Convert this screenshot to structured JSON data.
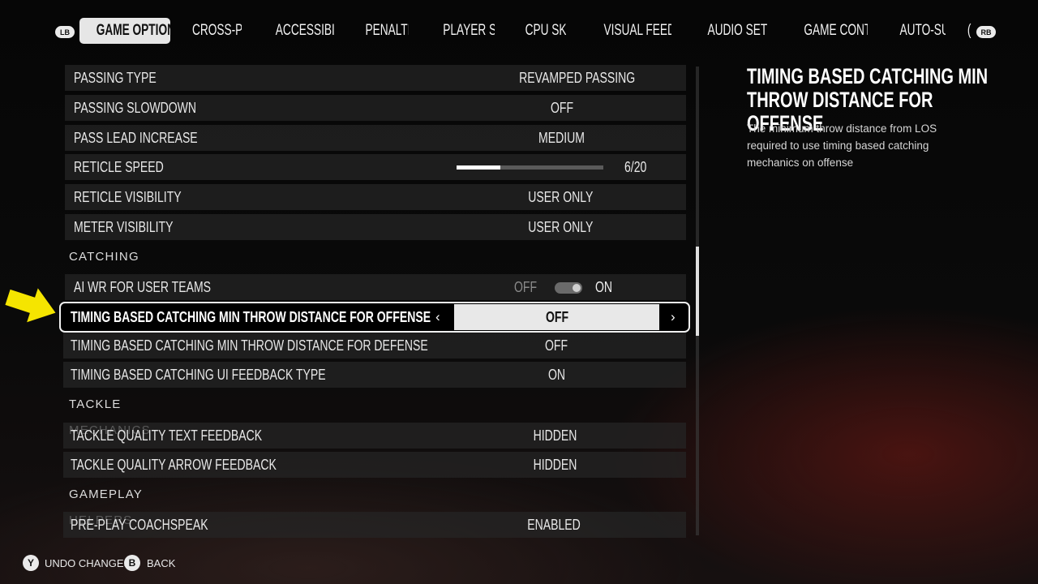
{
  "nav": {
    "left_bumper": "LB",
    "right_bumper": "RB",
    "tabs": [
      {
        "label": "GAME OPTIONS",
        "active": true
      },
      {
        "label": "CROSS-PLAY"
      },
      {
        "label": "ACCESSIBILITY"
      },
      {
        "label": "PENALTIES"
      },
      {
        "label": "PLAYER SKILL"
      },
      {
        "label": "CPU SKILL"
      },
      {
        "label": "VISUAL FEEDBACK"
      },
      {
        "label": "AUDIO SETTINGS"
      },
      {
        "label": "GAME CONTROLS"
      },
      {
        "label": "AUTO-SUBS"
      },
      {
        "label": "("
      }
    ]
  },
  "settings": {
    "passing_type": {
      "label": "PASSING TYPE",
      "value": "REVAMPED PASSING"
    },
    "passing_slowdown": {
      "label": "PASSING SLOWDOWN",
      "value": "OFF"
    },
    "pass_lead_increase": {
      "label": "PASS LEAD INCREASE",
      "value": "MEDIUM"
    },
    "reticle_speed": {
      "label": "RETICLE SPEED",
      "value_text": "6/20",
      "value": 6,
      "max": 20
    },
    "reticle_visibility": {
      "label": "RETICLE VISIBILITY",
      "value": "USER ONLY"
    },
    "meter_visibility": {
      "label": "METER VISIBILITY",
      "value": "USER ONLY"
    },
    "catching_header": "CATCHING",
    "ai_wr": {
      "label": "AI WR FOR USER TEAMS",
      "off": "OFF",
      "on": "ON",
      "state": "on"
    },
    "tbc_offense": {
      "label": "TIMING BASED CATCHING MIN THROW DISTANCE FOR OFFENSE",
      "value": "OFF",
      "prev": "‹",
      "next": "›"
    },
    "tbc_defense": {
      "label": "TIMING BASED CATCHING MIN THROW DISTANCE FOR DEFENSE",
      "value": "OFF"
    },
    "tbc_ui": {
      "label": "TIMING BASED CATCHING UI FEEDBACK TYPE",
      "value": "ON"
    },
    "tackle_header": "TACKLE MECHANICS",
    "tackle_text": {
      "label": "TACKLE QUALITY TEXT FEEDBACK",
      "value": "HIDDEN"
    },
    "tackle_arrow": {
      "label": "TACKLE QUALITY ARROW FEEDBACK",
      "value": "HIDDEN"
    },
    "helpers_header": "GAMEPLAY HELPERS",
    "coachspeak": {
      "label": "PRE-PLAY COACHSPEAK",
      "value": "ENABLED"
    }
  },
  "detail": {
    "title": "TIMING BASED CATCHING MIN THROW DISTANCE FOR OFFENSE",
    "description": "The minimum throw distance from LOS required to use timing based catching mechanics on offense"
  },
  "footer": {
    "undo_button": "Y",
    "undo_label": "UNDO CHANGES",
    "back_button": "B",
    "back_label": "BACK"
  },
  "colors": {
    "accent_arrow": "#f5e500",
    "selected_value_bg": "#e8e8e8",
    "row_bg": "#262626"
  }
}
